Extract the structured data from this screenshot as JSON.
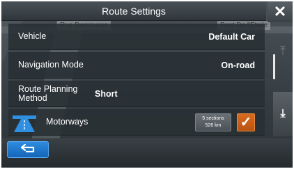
{
  "header": {
    "title": "Route Settings",
    "close_icon": "close-icon",
    "close_glyph": "✕"
  },
  "map": {
    "street_left": "Rue Desrousse",
    "street_right": "Pont De l'Etoile"
  },
  "settings": [
    {
      "label": "Vehicle",
      "value": "Default Car"
    },
    {
      "label": "Navigation Mode",
      "value": "On-road"
    },
    {
      "label": "Route Planning Method",
      "value": "Short"
    },
    {
      "label": "Motorways",
      "icon": "motorway-icon",
      "badge_line1": "5 sections",
      "badge_line2": "526 km",
      "checked": true,
      "check_glyph": "✓"
    }
  ],
  "scroll": {
    "top_icon": "scroll-to-top-icon",
    "top_glyph": "⤒",
    "down_icon": "scroll-down-icon",
    "down_glyph": "⤓"
  },
  "footer": {
    "back_icon": "back-arrow-icon"
  },
  "colors": {
    "accent_orange": "#d86b1e",
    "back_blue": "#1f78d1"
  }
}
